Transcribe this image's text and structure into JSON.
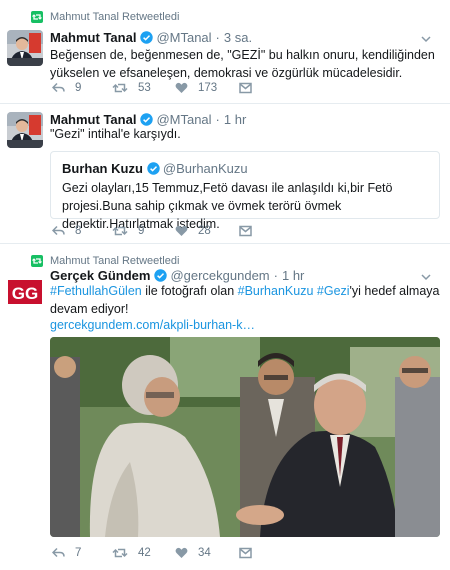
{
  "tweets": [
    {
      "retweeted_by": "Mahmut Tanal Retweetledi",
      "name": "Mahmut Tanal",
      "handle": "@MTanal",
      "time": "3 sa.",
      "text": "Beğensen de, beğenmesen de, \"GEZİ\" bu halkın onuru, kendiliğinden yükselen ve efsaneleşen, demokrasi ve özgürlük mücadelesidir.",
      "reply_count": "9",
      "retweet_count": "53",
      "like_count": "173"
    },
    {
      "name": "Mahmut Tanal",
      "handle": "@MTanal",
      "time": "1 hr",
      "text": "\"Gezi\" intihal'e karşıydı.",
      "quote": {
        "name": "Burhan Kuzu",
        "handle": "@BurhanKuzu",
        "text": "Gezi olayları,15 Temmuz,Fetö davası ile anlaşıldı ki,bir Fetö projesi.Buna sahip çıkmak ve övmek terörü övmek denektir.Hatırlatmak istedim."
      },
      "reply_count": "8",
      "retweet_count": "9",
      "like_count": "28"
    },
    {
      "retweeted_by": "Mahmut Tanal Retweetledi",
      "name": "Gerçek Gündem",
      "handle": "@gercekgundem",
      "time": "1 hr",
      "text_parts": {
        "tag1": "#FethullahGülen",
        "mid1": " ile fotoğrafı olan ",
        "tag2": "#BurhanKuzu",
        "mid2": " ",
        "tag3": "#Gezi",
        "end": "'yi hedef almaya devam ediyor!"
      },
      "link": "gercekgundem.com/akpli-burhan-k…",
      "avatar_text": "GG",
      "reply_count": "7",
      "retweet_count": "42",
      "like_count": "34"
    }
  ],
  "colors": {
    "accent": "#1b95e0",
    "retweet_green": "#17bf63",
    "muted": "#657786",
    "border": "#e6ecf0",
    "verified": "#1da1f2",
    "gg_red": "#c8102e"
  },
  "icons": [
    "retweet-icon",
    "verified-badge-icon",
    "chevron-down-icon",
    "reply-icon",
    "heart-icon",
    "message-icon"
  ]
}
